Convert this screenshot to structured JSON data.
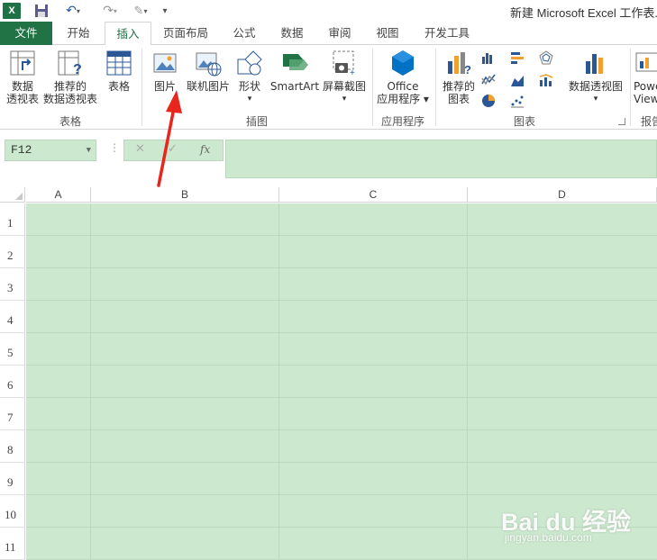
{
  "window": {
    "title": "新建 Microsoft Excel 工作表.x",
    "app_icon_letter": "X"
  },
  "tabs": [
    {
      "label": "文件"
    },
    {
      "label": "开始"
    },
    {
      "label": "插入"
    },
    {
      "label": "页面布局"
    },
    {
      "label": "公式"
    },
    {
      "label": "数据"
    },
    {
      "label": "审阅"
    },
    {
      "label": "视图"
    },
    {
      "label": "开发工具"
    }
  ],
  "active_tab": "插入",
  "ribbon": {
    "groups": [
      {
        "label": "表格"
      },
      {
        "label": "插图"
      },
      {
        "label": "应用程序"
      },
      {
        "label": "图表"
      },
      {
        "label": "报告"
      }
    ],
    "buttons": {
      "pivot_table": {
        "line1": "数据",
        "line2": "透视表"
      },
      "recommended_pivot": {
        "line1": "推荐的",
        "line2": "数据透视表"
      },
      "table": {
        "line1": "表格"
      },
      "pictures": {
        "line1": "图片"
      },
      "online_pictures": {
        "line1": "联机图片"
      },
      "shapes": {
        "line1": "形状",
        "line2": "▾"
      },
      "smartart": {
        "line1": "SmartArt"
      },
      "screenshot": {
        "line1": "屏幕截图",
        "line2": "▾"
      },
      "office_apps": {
        "line1": "Office",
        "line2": "应用程序 ▾"
      },
      "recommended_charts": {
        "line1": "推荐的",
        "line2": "图表"
      },
      "pivot_chart": {
        "line1": "数据透视图",
        "line2": "▾"
      },
      "power_view": {
        "line1": "Powe",
        "line2": "View"
      }
    }
  },
  "namebox": {
    "value": "F12"
  },
  "formula_bar": {
    "cancel": "✕",
    "enter": "✓",
    "fx": "fx",
    "separator": "⋮",
    "value": ""
  },
  "sheet": {
    "columns": [
      "A",
      "B",
      "C",
      "D"
    ],
    "rows": [
      "1",
      "2",
      "3",
      "4",
      "5",
      "6",
      "7",
      "8",
      "9",
      "10",
      "11"
    ]
  },
  "colors": {
    "excel_green": "#217346",
    "cell_fill": "#cce8cf",
    "annotation_red": "#e8261e"
  },
  "watermark": {
    "brand": "Bai du 经验",
    "url": "jingyan.baidu.com"
  }
}
